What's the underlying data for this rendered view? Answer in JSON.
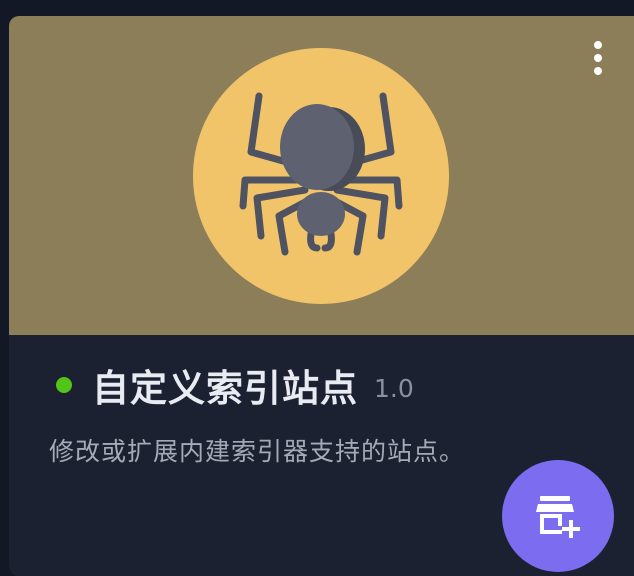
{
  "card": {
    "title": "自定义索引站点",
    "version": "1.0",
    "description": "修改或扩展内建索引器支持的站点。",
    "status": "enabled",
    "status_color": "#52c41a",
    "banner_color": "#8c7e58",
    "icon": "spider-icon"
  },
  "menu": {
    "icon": "more-vertical-icon"
  },
  "fab": {
    "icon": "store-add-icon",
    "color": "#7b6cf0"
  }
}
